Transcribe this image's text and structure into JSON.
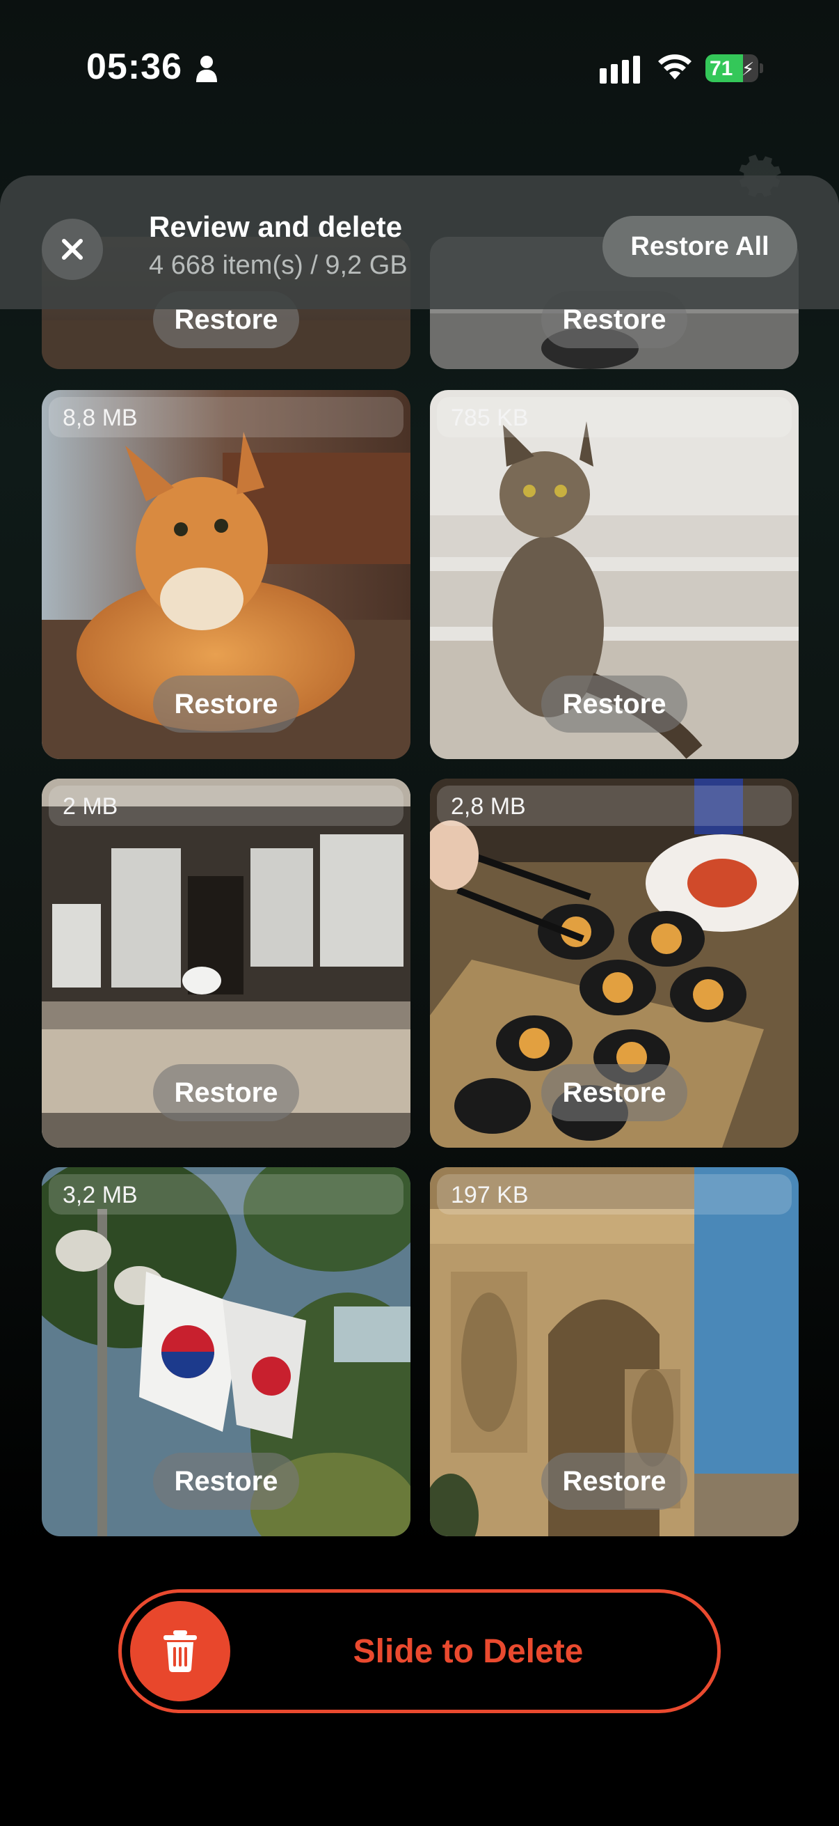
{
  "status_bar": {
    "time": "05:36",
    "battery_level": "71",
    "battery_fraction": 0.71,
    "icons": [
      "person-icon",
      "signal-icon",
      "wifi-icon",
      "battery-charging-icon"
    ]
  },
  "header": {
    "title": "Review and delete",
    "subtitle": "4 668 item(s) / 9,2 GB",
    "restore_all_label": "Restore All",
    "close_icon": "close-icon"
  },
  "tiles": [
    {
      "size": "",
      "restore_label": "Restore",
      "subject": "partial-photo-left"
    },
    {
      "size": "",
      "restore_label": "Restore",
      "subject": "partial-photo-right"
    },
    {
      "size": "8,8 MB",
      "restore_label": "Restore",
      "subject": "orange-cat"
    },
    {
      "size": "785 KB",
      "restore_label": "Restore",
      "subject": "tabby-cat-on-stairs"
    },
    {
      "size": "2 MB",
      "restore_label": "Restore",
      "subject": "cat-in-window"
    },
    {
      "size": "2,8 MB",
      "restore_label": "Restore",
      "subject": "kimbap-platter"
    },
    {
      "size": "3,2 MB",
      "restore_label": "Restore",
      "subject": "korean-flags"
    },
    {
      "size": "197 KB",
      "restore_label": "Restore",
      "subject": "arc-de-triomphe"
    }
  ],
  "slide": {
    "label": "Slide to Delete",
    "icon": "trash-icon"
  },
  "colors": {
    "accent": "#ea4a2f",
    "battery_green": "#34c759",
    "header_bg": "#3e4242"
  }
}
